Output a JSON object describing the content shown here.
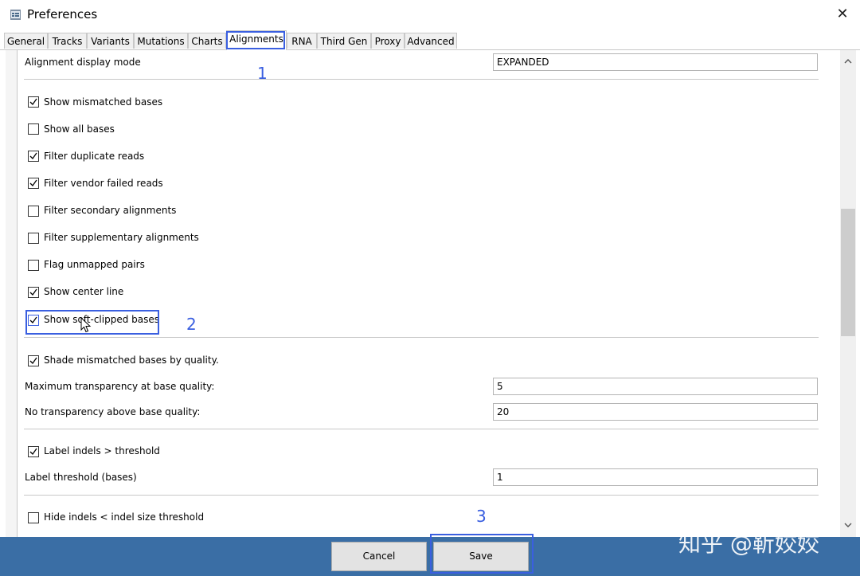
{
  "window": {
    "title": "Preferences",
    "close_glyph": "✕"
  },
  "tabs": [
    {
      "label": "General"
    },
    {
      "label": "Tracks"
    },
    {
      "label": "Variants"
    },
    {
      "label": "Mutations"
    },
    {
      "label": "Charts"
    },
    {
      "label": "Alignments",
      "active": true
    },
    {
      "label": "RNA"
    },
    {
      "label": "Third Gen"
    },
    {
      "label": "Proxy"
    },
    {
      "label": "Advanced"
    }
  ],
  "alignment_display_mode": {
    "label": "Alignment display mode",
    "value": "EXPANDED"
  },
  "checkboxes": [
    {
      "label": "Show mismatched bases",
      "checked": true
    },
    {
      "label": "Show all bases",
      "checked": false
    },
    {
      "label": "Filter duplicate reads",
      "checked": true
    },
    {
      "label": "Filter vendor failed reads",
      "checked": true
    },
    {
      "label": "Filter secondary alignments",
      "checked": false
    },
    {
      "label": "Filter supplementary alignments",
      "checked": false
    },
    {
      "label": "Flag unmapped pairs",
      "checked": false
    },
    {
      "label": "Show center line",
      "checked": true
    },
    {
      "label": "Show soft-clipped bases",
      "checked": true
    }
  ],
  "shade": {
    "label": "Shade mismatched bases by quality.",
    "checked": true
  },
  "max_transparency": {
    "label": "Maximum transparency at base quality:",
    "value": "5"
  },
  "no_transparency": {
    "label": "No transparency above base quality:",
    "value": "20"
  },
  "label_indels": {
    "label": "Label indels >  threshold",
    "checked": true
  },
  "label_threshold": {
    "label": "Label threshold (bases)",
    "value": "1"
  },
  "hide_indels": {
    "label": "Hide indels <  indel size threshold",
    "checked": false
  },
  "annotations": {
    "one": "1",
    "two": "2",
    "three": "3"
  },
  "buttons": {
    "cancel": "Cancel",
    "save": "Save"
  },
  "watermark": "知乎 @靳姣姣",
  "colors": {
    "highlight": "#3a5fe0",
    "bottom_bar": "#3a6ea5"
  },
  "icons": {
    "app": "preferences-app-icon",
    "close": "close-icon",
    "scroll_up": "chevron-up-icon",
    "scroll_down": "chevron-down-icon",
    "cursor": "mouse-pointer-icon"
  }
}
